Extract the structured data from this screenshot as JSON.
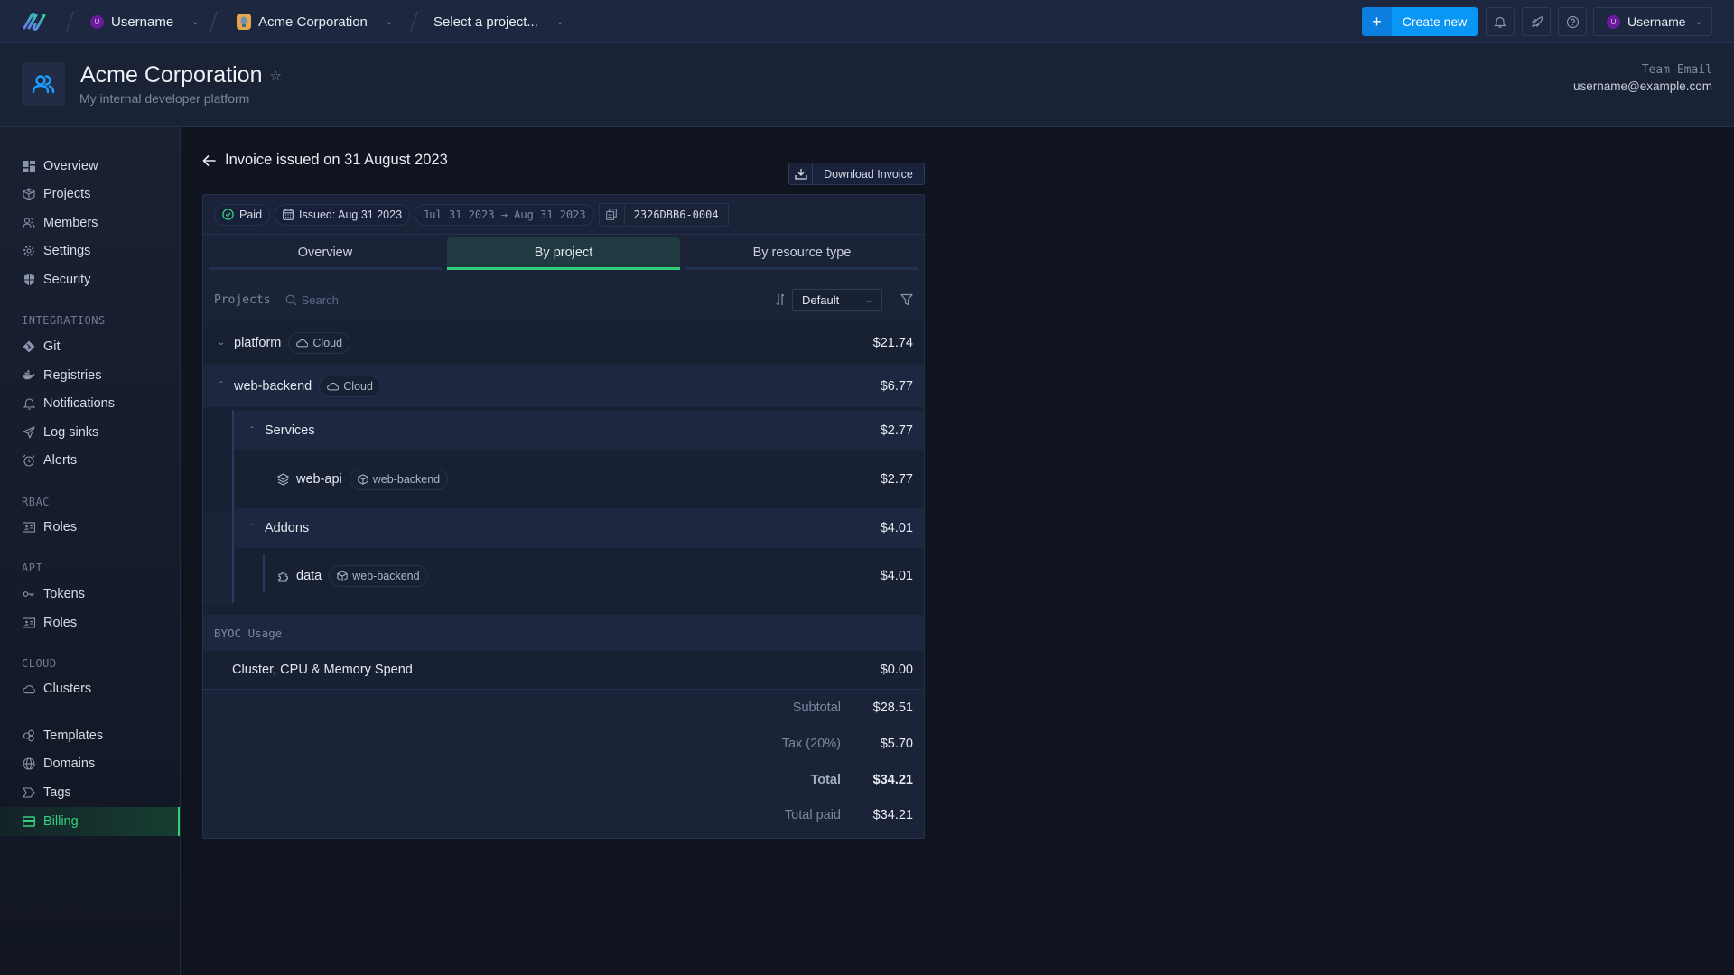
{
  "topbar": {
    "user_crumb": {
      "initial": "U",
      "label": "Username"
    },
    "org_crumb": {
      "label": "Acme Corporation"
    },
    "project_crumb": {
      "label": "Select a project..."
    },
    "create_label": "Create new",
    "user_menu": {
      "initial": "U",
      "label": "Username"
    }
  },
  "header": {
    "title": "Acme Corporation",
    "subtitle": "My internal developer platform",
    "team_email_label": "Team Email",
    "team_email": "username@example.com"
  },
  "sidebar": {
    "items": [
      {
        "label": "Overview",
        "icon": "grid-icon"
      },
      {
        "label": "Projects",
        "icon": "box-icon"
      },
      {
        "label": "Members",
        "icon": "users-icon"
      },
      {
        "label": "Settings",
        "icon": "gear-icon"
      },
      {
        "label": "Security",
        "icon": "shield-icon"
      }
    ],
    "sections": [
      {
        "title": "INTEGRATIONS",
        "items": [
          {
            "label": "Git",
            "icon": "git-icon"
          },
          {
            "label": "Registries",
            "icon": "docker-icon"
          },
          {
            "label": "Notifications",
            "icon": "bell-icon"
          },
          {
            "label": "Log sinks",
            "icon": "send-icon"
          },
          {
            "label": "Alerts",
            "icon": "alarm-icon"
          }
        ]
      },
      {
        "title": "RBAC",
        "items": [
          {
            "label": "Roles",
            "icon": "id-card-icon"
          }
        ]
      },
      {
        "title": "API",
        "items": [
          {
            "label": "Tokens",
            "icon": "key-icon"
          },
          {
            "label": "Roles",
            "icon": "id-card-icon"
          }
        ]
      },
      {
        "title": "CLOUD",
        "items": [
          {
            "label": "Clusters",
            "icon": "cloud-icon"
          }
        ]
      }
    ],
    "bottom_items": [
      {
        "label": "Templates",
        "icon": "templates-icon"
      },
      {
        "label": "Domains",
        "icon": "globe-icon"
      },
      {
        "label": "Tags",
        "icon": "tag-icon"
      },
      {
        "label": "Billing",
        "icon": "credit-card-icon",
        "active": true
      }
    ]
  },
  "invoice": {
    "title": "Invoice issued on 31 August 2023",
    "download_label": "Download Invoice",
    "status": "Paid",
    "issued": "Issued: Aug 31 2023",
    "period": "Jul 31 2023 → Aug 31 2023",
    "invoice_id": "2326DBB6-0004",
    "tabs": [
      {
        "label": "Overview",
        "active": false
      },
      {
        "label": "By project",
        "active": true
      },
      {
        "label": "By resource type",
        "active": false
      }
    ],
    "toolbar": {
      "label": "Projects",
      "search_placeholder": "Search",
      "sort_value": "Default"
    },
    "projects": [
      {
        "name": "platform",
        "tag": "Cloud",
        "amount": "$21.74",
        "expanded": false
      },
      {
        "name": "web-backend",
        "tag": "Cloud",
        "amount": "$6.77",
        "expanded": true,
        "groups": [
          {
            "name": "Services",
            "amount": "$2.77",
            "items": [
              {
                "name": "web-api",
                "project": "web-backend",
                "amount": "$2.77"
              }
            ]
          },
          {
            "name": "Addons",
            "amount": "$4.01",
            "items": [
              {
                "name": "data",
                "project": "web-backend",
                "amount": "$4.01"
              }
            ]
          }
        ]
      }
    ],
    "byoc": {
      "label": "BYOC Usage",
      "item": "Cluster, CPU & Memory Spend",
      "amount": "$0.00"
    },
    "summary": {
      "subtotal_label": "Subtotal",
      "subtotal": "$28.51",
      "tax_label": "Tax (20%)",
      "tax": "$5.70",
      "total_label": "Total",
      "total": "$34.21",
      "paid_label": "Total paid",
      "paid": "$34.21"
    }
  },
  "colors": {
    "accent": "#0996f5",
    "active": "#35d07f",
    "background": "#10141f"
  }
}
